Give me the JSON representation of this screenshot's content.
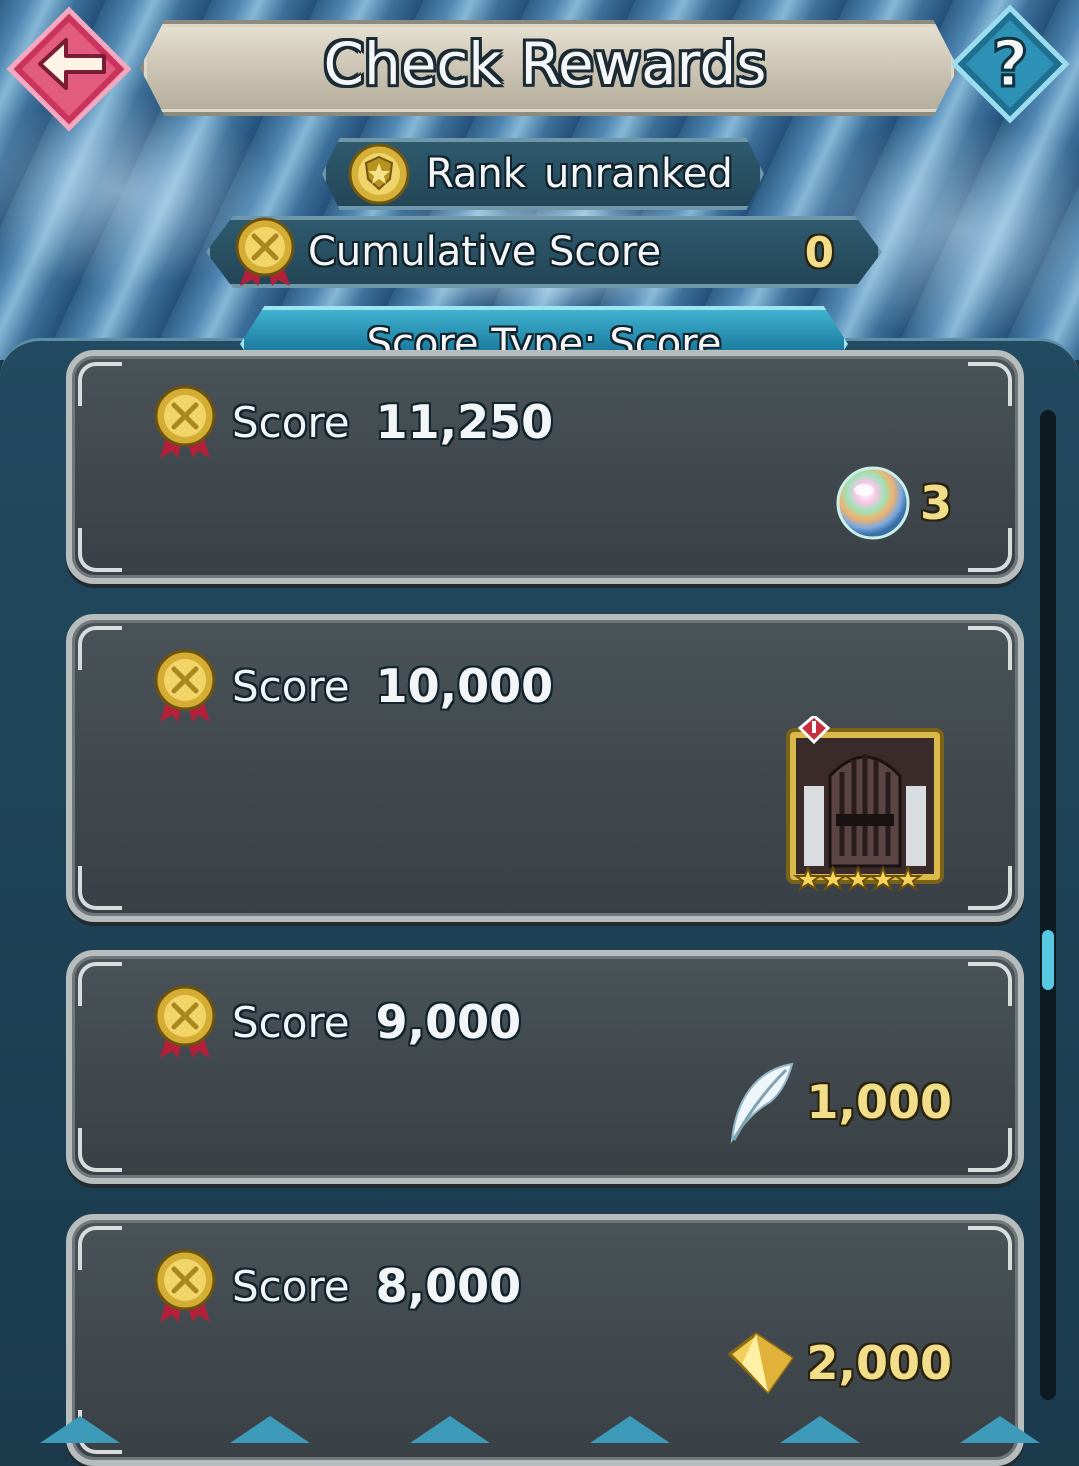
{
  "header": {
    "title": "Check Rewards"
  },
  "rank": {
    "label": "Rank",
    "value": "unranked"
  },
  "cumulative": {
    "label": "Cumulative Score",
    "value": "0"
  },
  "score_type": {
    "label": "Score Type: Score"
  },
  "rewards": [
    {
      "score_label": "Score",
      "score_value": "11,250",
      "item_icon": "orb-icon",
      "quantity": "3"
    },
    {
      "score_label": "Score",
      "score_value": "10,000",
      "item_icon": "hero-portrait-armored-knight-icon",
      "quantity": ""
    },
    {
      "score_label": "Score",
      "score_value": "9,000",
      "item_icon": "feather-icon",
      "quantity": "1,000"
    },
    {
      "score_label": "Score",
      "score_value": "8,000",
      "item_icon": "crystal-icon",
      "quantity": "2,000"
    }
  ],
  "scroll": {
    "position": 0.55
  },
  "colors": {
    "accent_teal": "#3fb3cf",
    "gold_text": "#f2de8a",
    "back_button": "#e0577a"
  }
}
